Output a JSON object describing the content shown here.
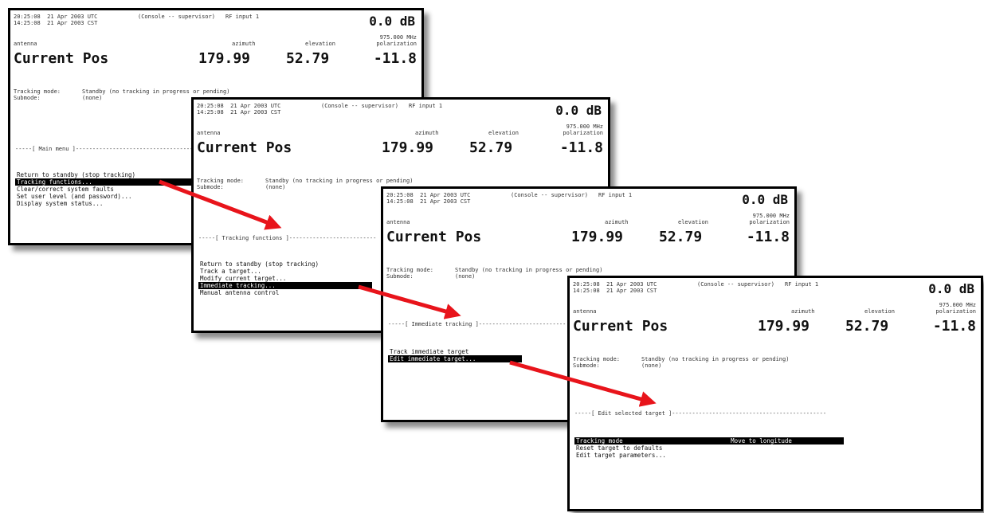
{
  "header": {
    "utc": "20:25:08  21 Apr 2003 UTC",
    "cst": "14:25:08  21 Apr 2003 CST",
    "console": "(Console -- supervisor)",
    "rf": "RF input 1",
    "level": "0.0 dB",
    "freq": "975.000 MHz",
    "polarization_label": "polarization",
    "antenna_label": "antenna",
    "azimuth_label": "azimuth",
    "elevation_label": "elevation",
    "current_pos": "Current Pos",
    "azimuth": "179.99",
    "elevation": "52.79",
    "polarization": "-11.8",
    "tracking_mode_label": "Tracking mode:",
    "tracking_mode_value": "Standby (no tracking in progress or pending)",
    "submode_label": "Submode:",
    "submode_value": "(none)"
  },
  "screens": [
    {
      "menu_title": "-----[ Main menu ]-----------------------------------",
      "items": [
        "Return to standby (stop tracking)",
        "Tracking functions...",
        "Clear/correct system faults",
        "Set user level (and password)...",
        "Display system status..."
      ],
      "selected": 1
    },
    {
      "menu_title": "-----[ Tracking functions ]--------------------------",
      "items": [
        "Return to standby (stop tracking)",
        "Track a target...",
        "Modify current target...",
        "Immediate tracking...",
        "Manual antenna control"
      ],
      "selected": 3
    },
    {
      "menu_title": "-----[ Immediate tracking ]--------------------------",
      "items": [
        "Track immediate target",
        "Edit immediate target..."
      ],
      "selected": 1
    },
    {
      "menu_title": "-----[ Edit selected target ]----------------------------------------------",
      "items": [
        "Tracking mode                              Move to longitude",
        "Reset target to defaults",
        "Edit target parameters..."
      ],
      "selected": 0
    }
  ],
  "colors": {
    "arrow": "#e8141b",
    "selection": "#000000"
  }
}
